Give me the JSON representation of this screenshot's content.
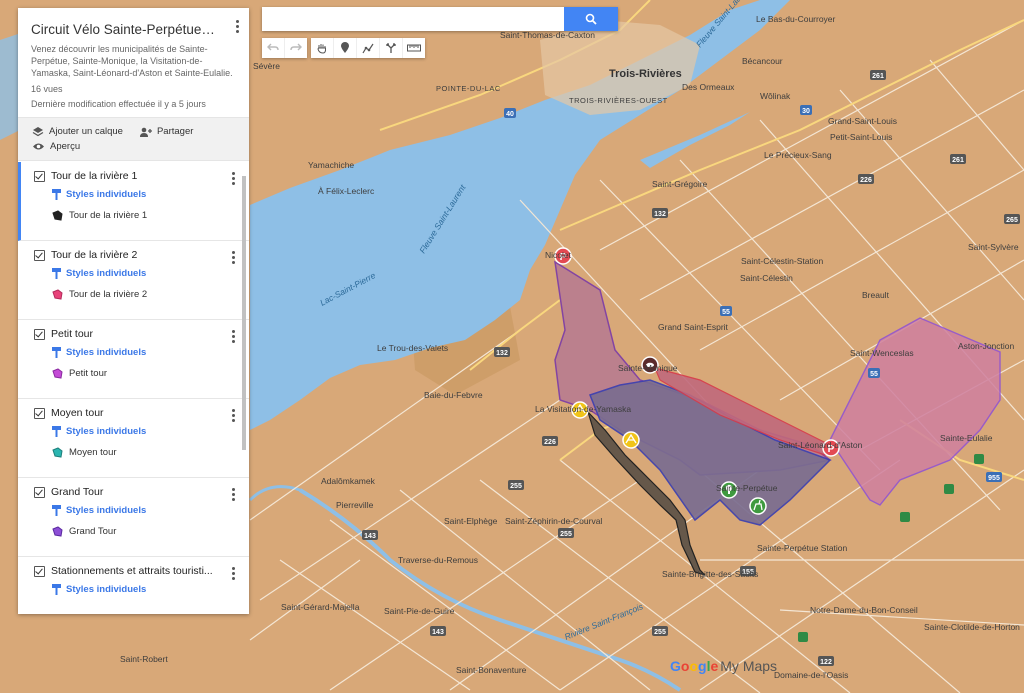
{
  "search": {
    "placeholder": ""
  },
  "panel": {
    "title": "Circuit Vélo Sainte-Perpétue est c...",
    "description": "Venez découvrir les municipalités de Sainte-Perpétue, Sainte-Monique, la Visitation-de-Yamaska, Saint-Léonard-d'Aston et Sainte-Eulalie.",
    "views": "16 vues",
    "modified": "Dernière modification effectuée il y a 5 jours",
    "actions": {
      "add_layer": "Ajouter un calque",
      "share": "Partager",
      "preview": "Aperçu"
    }
  },
  "layers": [
    {
      "name": "Tour de la rivière 1",
      "style": "Styles individuels",
      "feature": "Tour de la rivière 1",
      "color": "#222222"
    },
    {
      "name": "Tour de la rivière 2",
      "style": "Styles individuels",
      "feature": "Tour de la rivière 2",
      "color": "#e8437a"
    },
    {
      "name": "Petit tour",
      "style": "Styles individuels",
      "feature": "Petit tour",
      "color": "#c44bd6"
    },
    {
      "name": "Moyen tour",
      "style": "Styles individuels",
      "feature": "Moyen tour",
      "color": "#2bb5b0"
    },
    {
      "name": "Grand Tour",
      "style": "Styles individuels",
      "feature": "Grand Tour",
      "color": "#8d4fd6"
    },
    {
      "name": "Stationnements et attraits touristi...",
      "style": "Styles individuels"
    }
  ],
  "map_labels": {
    "trois_rivieres": "Trois-Rivières",
    "tr_ouest": "TROIS-RIVIÈRES-OUEST",
    "pointe_du_lac": "POINTE-DU-LAC",
    "st_thomas": "Saint-Thomas-de-Caxton",
    "bas_courroyer": "Le Bas-du-Courroyer",
    "becancour": "Bécancour",
    "des_ormeaux": "Des Ormeaux",
    "wolinak": "Wôlinak",
    "gd_st_louis": "Grand-Saint-Louis",
    "pt_st_louis": "Petit-Saint-Louis",
    "precieux_sang": "Le Précieux-Sang",
    "st_gregoire": "Saint-Grégoire",
    "st_sylvere": "Saint-Sylvère",
    "st_celestin_station": "Saint-Célestin-Station",
    "st_celestin": "Saint-Célestin",
    "breault": "Breault",
    "gd_st_esprit": "Grand Saint-Esprit",
    "st_wenceslas": "Saint-Wenceslas",
    "aston_jonction": "Aston-Jonction",
    "ste_eulalie": "Sainte-Eulalie",
    "st_leonard": "Saint-Léonard-d'Aston",
    "ste_perpetue_station": "Sainte-Perpétue Station",
    "ste_brigitte": "Sainte-Brigitte-des-Saults",
    "notre_dame": "Notre-Dame-du-Bon-Conseil",
    "ste_clotilde": "Sainte-Clotilde-de-Horton",
    "domaine_oasis": "Domaine-de-l'Oasis",
    "st_bonaventure": "Saint-Bonaventure",
    "st_pie": "Saint-Pie-de-Guire",
    "st_gerard": "Saint-Gérard-Majella",
    "st_robert": "Saint-Robert",
    "traverse": "Traverse-du-Remous",
    "st_elphege": "Saint-Elphège",
    "st_zephirin": "Saint-Zéphirin-de-Courval",
    "pierreville": "Pierreville",
    "adalomkamek": "Adalômkamek",
    "baie_febvre": "Baie-du-Febvre",
    "trou_valets": "Le Trou-des-Valets",
    "lac_st_pierre": "Lac-Saint-Pierre",
    "fleuve_st_laurent": "Fleuve Saint-Laurent",
    "fleuve_st_laurent_2": "Fleuve Saint-Laurent",
    "riviere_st_francois": "Rivière Saint-François",
    "yamachiche": "Yamachiche",
    "felix_leclerc": "À Félix-Leclerc",
    "severe": "Sévère",
    "visitation": "La Visitation-de-Yamaska",
    "nicolet": "Nicolet",
    "ste_monique": "Sainte-Monique",
    "ste_perpetue": "Sainte-Perpétue"
  },
  "shields": [
    "132",
    "40",
    "55",
    "30",
    "261",
    "265",
    "226",
    "155",
    "255",
    "143",
    "122",
    "955"
  ],
  "footer": {
    "google": "Google",
    "mymaps": "My Maps"
  }
}
